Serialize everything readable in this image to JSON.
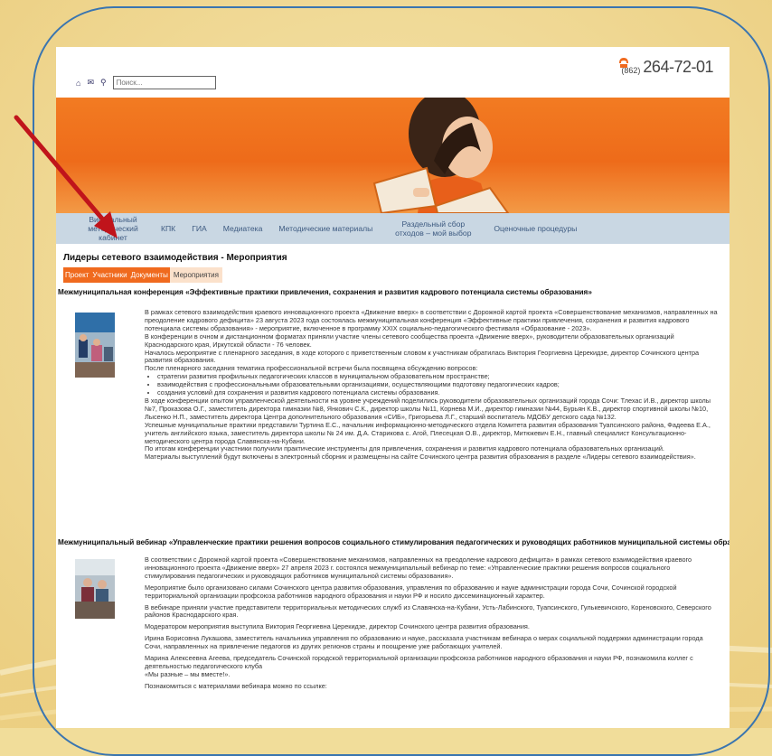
{
  "header": {
    "search_placeholder": "Поиск...",
    "phone_code": "(862)",
    "phone_number": "264-72-01"
  },
  "nav": {
    "items": [
      "Виртуальный методический кабинет",
      "КПК",
      "ГИА",
      "Медиатека",
      "Методические материалы",
      "Раздельный сбор отходов – мой выбор",
      "Оценочные процедуры"
    ]
  },
  "page": {
    "title": "Лидеры сетевого взаимодействия - Мероприятия",
    "tabs": [
      "Проект",
      "Участники",
      "Документы",
      "Мероприятия"
    ]
  },
  "article1": {
    "title": "Межмуниципальная конференция «Эффективные практики привлечения, сохранения и развития кадрового потенциала системы образования»",
    "p1": "В рамках сетевого взаимодействия краевого инновационного проекта «Движение вверх» в соответствии с Дорожной картой проекта «Совершенствование механизмов, направленных на преодоление кадрового дефицита» 23 августа 2023 года состоялась межмуниципальная конференция «Эффективные практики привлечения, сохранения и развития кадрового потенциала системы образования» - мероприятие, включенное в программу XXIX социально-педагогического фестиваля «Образование - 2023».",
    "p2": "В конференции в очном и дистанционном форматах приняли участие члены сетевого сообщества проекта «Движение вверх», руководители образовательных организаций Краснодарского края, Иркутской области - 76 человек.",
    "p3": "Началось мероприятие с пленарного заседания, в ходе которого с приветственным словом к участникам обратилась Виктория Георгиевна Церекидзе, директор Сочинского центра развития образования.",
    "p4": "После пленарного заседания тематика профессиональной встречи была посвящена обсуждению вопросов:",
    "bullets": [
      "стратегии развития профильных педагогических классов в муниципальном образовательном пространстве;",
      "взаимодействия с профессиональными образовательными организациями, осуществляющими подготовку педагогических кадров;",
      "создания условий для сохранения и развития кадрового потенциала системы образования."
    ],
    "p5": "В ходе конференции опытом управленческой деятельности на уровне учреждений поделились руководители образовательных организаций города Сочи: Тлехас И.В., директор школы №7, Проказова О.Г., заместитель директора гимназии №8, Янкович С.К., директор школы №11, Корнева М.И., директор гимназии №44, Бурьян К.В., директор спортивной школы №10, Лысенко Н.П., заместитель директора Центра дополнительного образования «СИБ», Григорьева Л.Г., старший воспитатель МДОБУ детского сада №132.",
    "p6": "Успешные муниципальные практики представили Туртина Е.С., начальник информационно-методического отдела Комитета развития образования Туапсинского района, Фадеева Е.А., учитель английского языка, заместитель директора школы № 24 им. Д.А. Старикова с. Агой, Плесецкая О.В., директор, Митюкевич Е.Н., главный специалист Консультационно-методического центра города Славянска-на-Кубани.",
    "p7": "По итогам конференции участники получили практические инструменты для привлечения, сохранения и развития кадрового потенциала образовательных организаций.",
    "p8": "Материалы выступлений будут включены в электронный сборник и размещены на сайте Сочинского центра развития образования в разделе «Лидеры сетевого взаимодействия»."
  },
  "article2": {
    "title": "Межмуниципальный вебинар «Управленческие практики решения вопросов социального стимулирования педагогических и руководящих работников муниципальной системы образования»",
    "p1": "В соответствии с Дорожной картой проекта «Совершенствование механизмов, направленных на преодоление кадрового дефицита» в рамках сетевого взаимодействия краевого инновационного проекта «Движение вверх» 27 апреля 2023 г. состоялся межмуниципальный вебинар по теме: «Управленческие практики решения вопросов социального стимулирования педагогических и руководящих работников муниципальной системы образования».",
    "p2": "Мероприятие было организовано силами Сочинского центра развития образования, управления по образованию и науке администрации города Сочи, Сочинской городской территориальной организации профсоюза работников народного образования и науки РФ и носило диссеминационный характер.",
    "p3": "В вебинаре приняли участие представители территориальных методических служб из Славянска-на-Кубани, Усть-Лабинского, Туапсинского, Гулькевичского, Кореновского, Северского районов Краснодарского края.",
    "p4": "Модератором мероприятия выступила Виктория Георгиевна Церекидзе, директор Сочинского центра развития образования.",
    "p5": "Ирина Борисовна Лукашова, заместитель начальника управления по образованию и науке, рассказала участникам вебинара о мерах социальной поддержки администрации города Сочи, направленных на привлечение педагогов из других регионов страны и поощрение уже работающих учителей.",
    "p6": "Марина Алексеевна Агеева, председатель Сочинской городской территориальной организации профсоюза работников народного образования и науки РФ, познакомила коллег с деятельностью педагогического клуба",
    "p7": "«Мы разные – мы вместе!».",
    "p8": "Познакомиться с материалами вебинара можно по ссылке:"
  },
  "colors": {
    "frame": "#3a75b0",
    "arrow": "#c0141b",
    "accent": "#f06a1e",
    "nav": "#c9d7e3"
  }
}
